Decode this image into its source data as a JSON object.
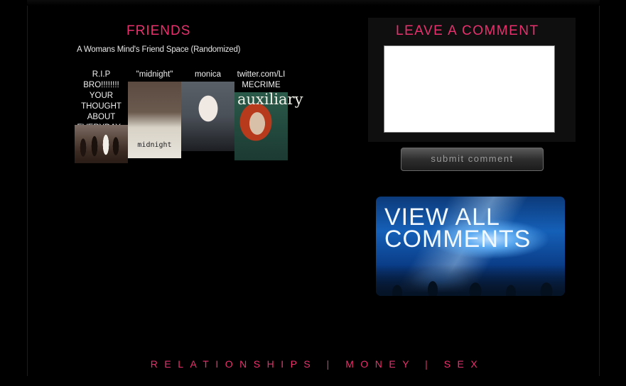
{
  "friends": {
    "title": "FRIENDS",
    "subtitle": "A Womans Mind's Friend Space (Randomized)",
    "items": [
      {
        "name": "R.I.P BRO!!!!!!!! YOUR THOUGHT ABOUT EVERYDAY~"
      },
      {
        "name": "\"midnight\"",
        "image_text": "midnight"
      },
      {
        "name": "monica"
      },
      {
        "name": "twitter.com/LI MECRIME",
        "image_text": "auxiliary"
      }
    ]
  },
  "comment": {
    "title": "LEAVE A COMMENT",
    "textarea_value": "",
    "submit_label": "submit comment"
  },
  "view_all": {
    "label": "VIEW ALL COMMENTS"
  },
  "footer": {
    "links": [
      "RELATIONSHIPS",
      "MONEY",
      "SEX"
    ],
    "separator": "|"
  },
  "colors": {
    "accent": "#e8306e",
    "background": "#000000"
  }
}
